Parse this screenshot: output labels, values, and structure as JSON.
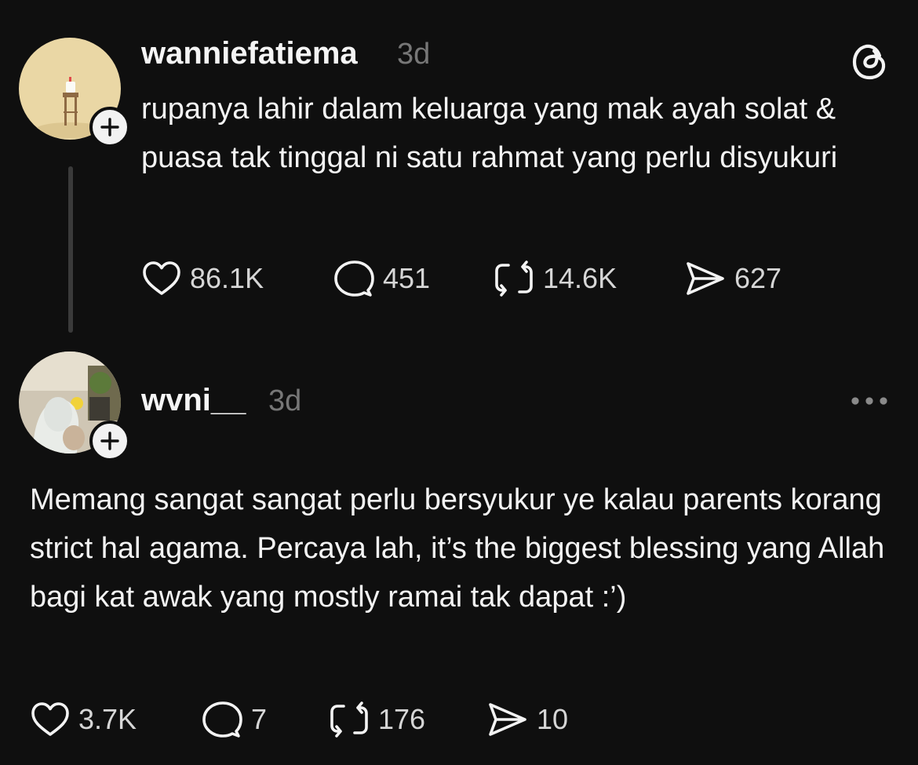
{
  "posts": [
    {
      "username": "wanniefatiema",
      "time": "3d",
      "text": "rupanya lahir dalam keluarga yang mak ayah solat & puasa tak tinggal ni satu rahmat yang perlu disyukuri",
      "avatar_icon": "avatar-photo-stool-cake",
      "actions": {
        "likes": "86.1K",
        "replies": "451",
        "reposts": "14.6K",
        "shares": "627"
      }
    },
    {
      "username": "wvni__",
      "time": "3d",
      "text": "Memang sangat sangat perlu bersyukur ye kalau parents korang strict hal agama. Percaya lah, it’s the biggest blessing yang Allah bagi kat awak yang mostly ramai tak dapat :’)",
      "avatar_icon": "avatar-photo-person-hijab",
      "actions": {
        "likes": "3.7K",
        "replies": "7",
        "reposts": "176",
        "shares": "10"
      }
    }
  ],
  "icons": {
    "threads_logo": "threads-logo-icon",
    "more": "more-options-icon",
    "follow": "plus-icon",
    "like": "heart-icon",
    "reply": "comment-icon",
    "repost": "repost-icon",
    "share": "share-icon"
  },
  "colors": {
    "background": "#0f0f0f",
    "text": "#f3f3f3",
    "muted": "#777777",
    "badge": "#f2f2f2"
  }
}
